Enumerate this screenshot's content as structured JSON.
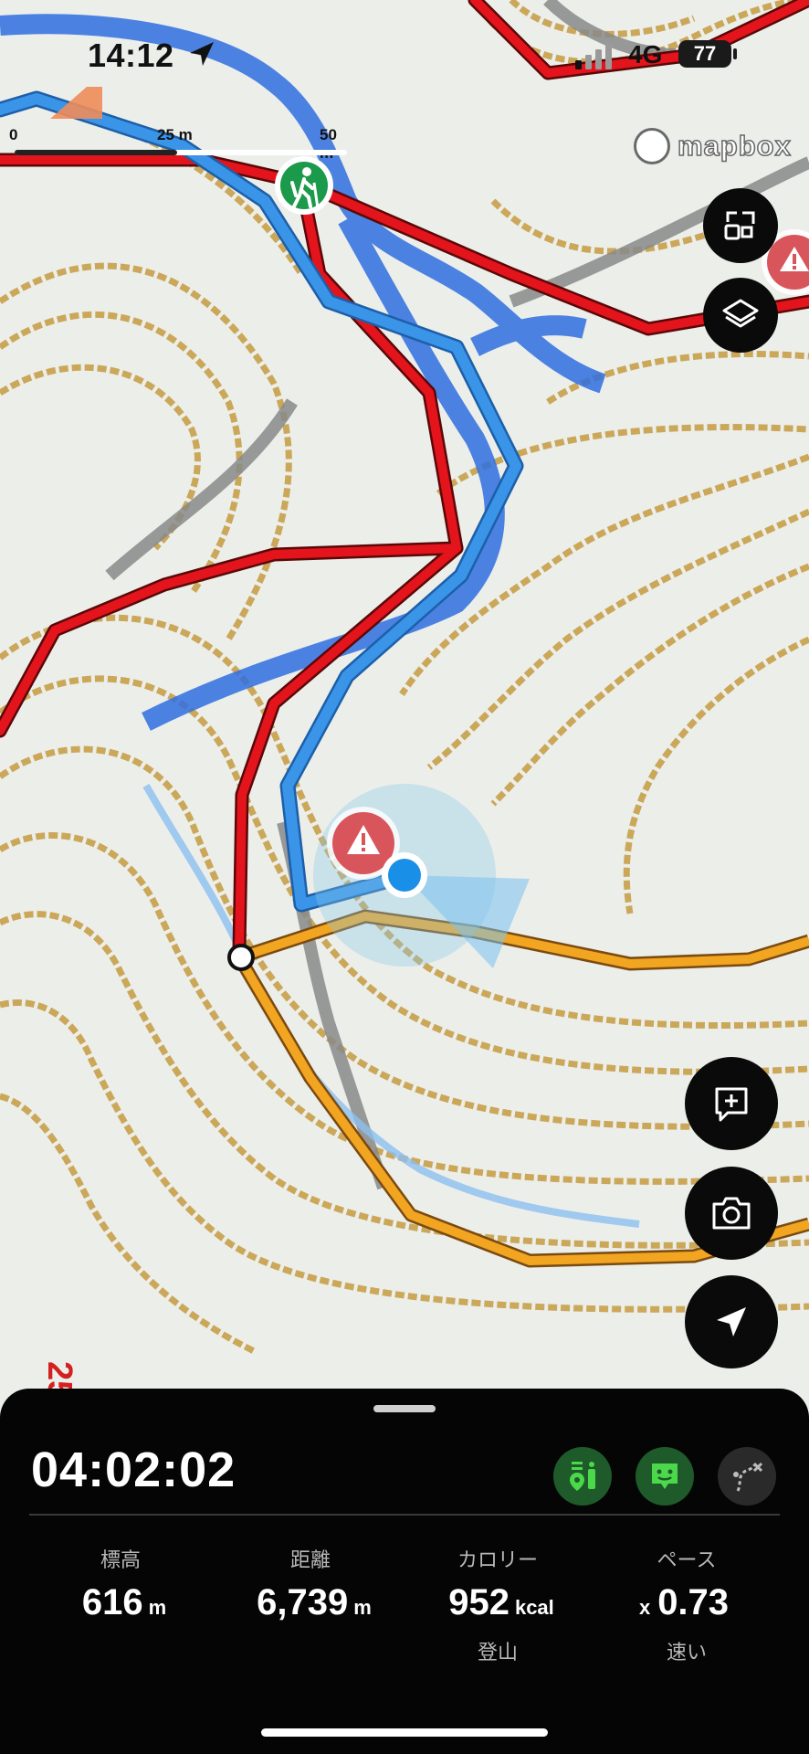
{
  "status_bar": {
    "time": "14:12",
    "network": "4G",
    "battery": "77"
  },
  "map": {
    "scale": {
      "label_0": "0",
      "label_25": "25 m",
      "label_50": "50 m"
    },
    "attribution": "mapbox",
    "corner_label": "25",
    "route_colors": {
      "red_route": "#e3141c",
      "blue_track": "#3a94e8",
      "orange_route": "#f2a521"
    }
  },
  "controls": {
    "expand": "expand-icon",
    "layers": "layers-icon",
    "add_note": "add-note-icon",
    "camera": "camera-icon",
    "locate": "navigation-arrow-icon"
  },
  "bottom_panel": {
    "elapsed_time": "04:02:02",
    "icons": [
      "course-marker-icon",
      "chat-message-icon",
      "route-off-icon"
    ],
    "stats": [
      {
        "label": "標高",
        "value": "616",
        "unit": "m",
        "prefix": "",
        "sub": ""
      },
      {
        "label": "距離",
        "value": "6,739",
        "unit": "m",
        "prefix": "",
        "sub": ""
      },
      {
        "label": "カロリー",
        "value": "952",
        "unit": "kcal",
        "prefix": "",
        "sub": "登山"
      },
      {
        "label": "ペース",
        "value": "0.73",
        "unit": "",
        "prefix": "x",
        "sub": "速い"
      }
    ]
  }
}
